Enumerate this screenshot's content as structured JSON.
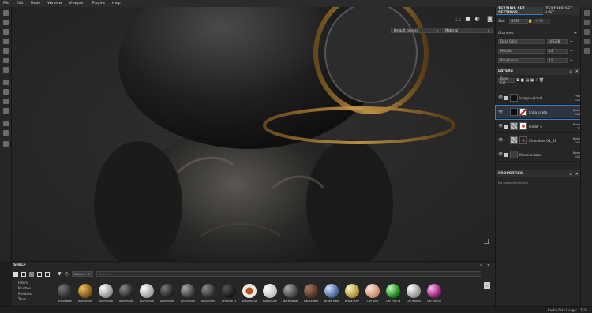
{
  "menubar": {
    "items": [
      "File",
      "Edit",
      "Mode",
      "Window",
      "Viewport",
      "Plugins",
      "Help"
    ]
  },
  "viewport": {
    "channel_select": "Default camera",
    "view_select": "Material"
  },
  "texture_set": {
    "tabs": [
      "TEXTURE SET SETTINGS",
      "TEXTURE SET LIST"
    ],
    "size_label": "Size",
    "size_value": "4096",
    "size_value2": "4096",
    "channels_label": "Channels",
    "channels": [
      {
        "name": "Base Color",
        "format": "sRGB8"
      },
      {
        "name": "Metallic",
        "format": "L8"
      },
      {
        "name": "Roughness",
        "format": "L8"
      }
    ]
  },
  "layers": {
    "title": "LAYERS",
    "channel_filter": "Base Col",
    "items": [
      {
        "name": "integra-global",
        "blend": "Pthr",
        "opacity": "100"
      },
      {
        "name": "linha_preta",
        "blend": "Norm",
        "opacity": "100"
      },
      {
        "name": "Folder 4",
        "blend": "Norm",
        "opacity": "37"
      },
      {
        "name": "Chocolate 01_02",
        "blend": "Norm",
        "opacity": "100"
      },
      {
        "name": "Madeira-base",
        "blend": "Norm",
        "opacity": "100"
      }
    ]
  },
  "properties": {
    "title": "PROPERTIES",
    "hint": "No properties found"
  },
  "shelf": {
    "title": "SHELF",
    "filter_chip": "Materi...",
    "search_placeholder": "Search...",
    "categories": [
      "Filters",
      "Brushes",
      "Particles",
      "Tools"
    ],
    "materials": [
      {
        "name": "Art Season T...",
        "color": "#3b3b3b"
      },
      {
        "name": "Aluminium ...",
        "color": "#b07a22"
      },
      {
        "name": "Aluminium ...",
        "color": "#d8d8d8"
      },
      {
        "name": "Aluminium ...",
        "color": "#4a4a4a"
      },
      {
        "name": "Aluminium ...",
        "color": "#cfcfcf"
      },
      {
        "name": "Aluminium ...",
        "color": "#3a3a3a"
      },
      {
        "name": "Aluminium ...",
        "color": "#5a5a5a"
      },
      {
        "name": "Ancient Metal",
        "color": "#4d4d4d"
      },
      {
        "name": "Artificial Lea...",
        "color": "#2c2c2c"
      },
      {
        "name": "Autumn Leaf",
        "color": "#e6d9d0"
      },
      {
        "name": "Baked Light...",
        "color": "#e9e9e9"
      },
      {
        "name": "Bare Metal",
        "color": "#6f6f6f"
      },
      {
        "name": "Bat Leather",
        "color": "#7a5a48"
      },
      {
        "name": "Brake Rotor...",
        "color": "#8fa6c5"
      },
      {
        "name": "Brass Pure",
        "color": "#d8c36a"
      },
      {
        "name": "Calf Skin",
        "color": "#e7b69c"
      },
      {
        "name": "Car Plus Pai...",
        "color": "#19b319"
      },
      {
        "name": "Car Headlin...",
        "color": "#bdbdbd"
      },
      {
        "name": "Car Interior...",
        "color": "#d21fa0"
      }
    ]
  },
  "status": {
    "label": "Cache Disk Usage:",
    "value": "71%"
  }
}
